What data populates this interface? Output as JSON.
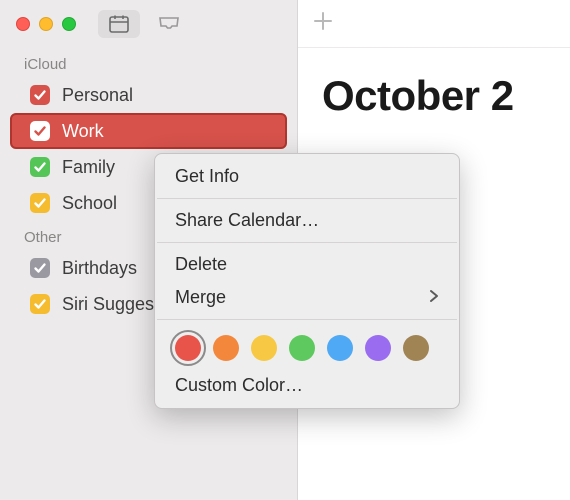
{
  "sidebar": {
    "sections": [
      {
        "header": "iCloud",
        "items": [
          {
            "label": "Personal",
            "color": "#d6524b",
            "checked": true,
            "selected": false
          },
          {
            "label": "Work",
            "color": "#d6524b",
            "checked": true,
            "selected": true
          },
          {
            "label": "Family",
            "color": "#55c558",
            "checked": true,
            "selected": false
          },
          {
            "label": "School",
            "color": "#f6bc2f",
            "checked": true,
            "selected": false
          }
        ]
      },
      {
        "header": "Other",
        "items": [
          {
            "label": "Birthdays",
            "color": "#9a98a0",
            "checked": true,
            "selected": false
          },
          {
            "label": "Siri Suggestions",
            "color": "#f6bc2f",
            "checked": true,
            "selected": false
          }
        ]
      }
    ]
  },
  "main": {
    "title": "October 2"
  },
  "context_menu": {
    "get_info": "Get Info",
    "share": "Share Calendar…",
    "delete": "Delete",
    "merge": "Merge",
    "custom_color": "Custom Color…",
    "colors": [
      {
        "hex": "#e8534a",
        "selected": true
      },
      {
        "hex": "#f3873c",
        "selected": false
      },
      {
        "hex": "#f6c843",
        "selected": false
      },
      {
        "hex": "#5ec95e",
        "selected": false
      },
      {
        "hex": "#4fa9f4",
        "selected": false
      },
      {
        "hex": "#9a6cf0",
        "selected": false
      },
      {
        "hex": "#a08454",
        "selected": false
      }
    ]
  }
}
